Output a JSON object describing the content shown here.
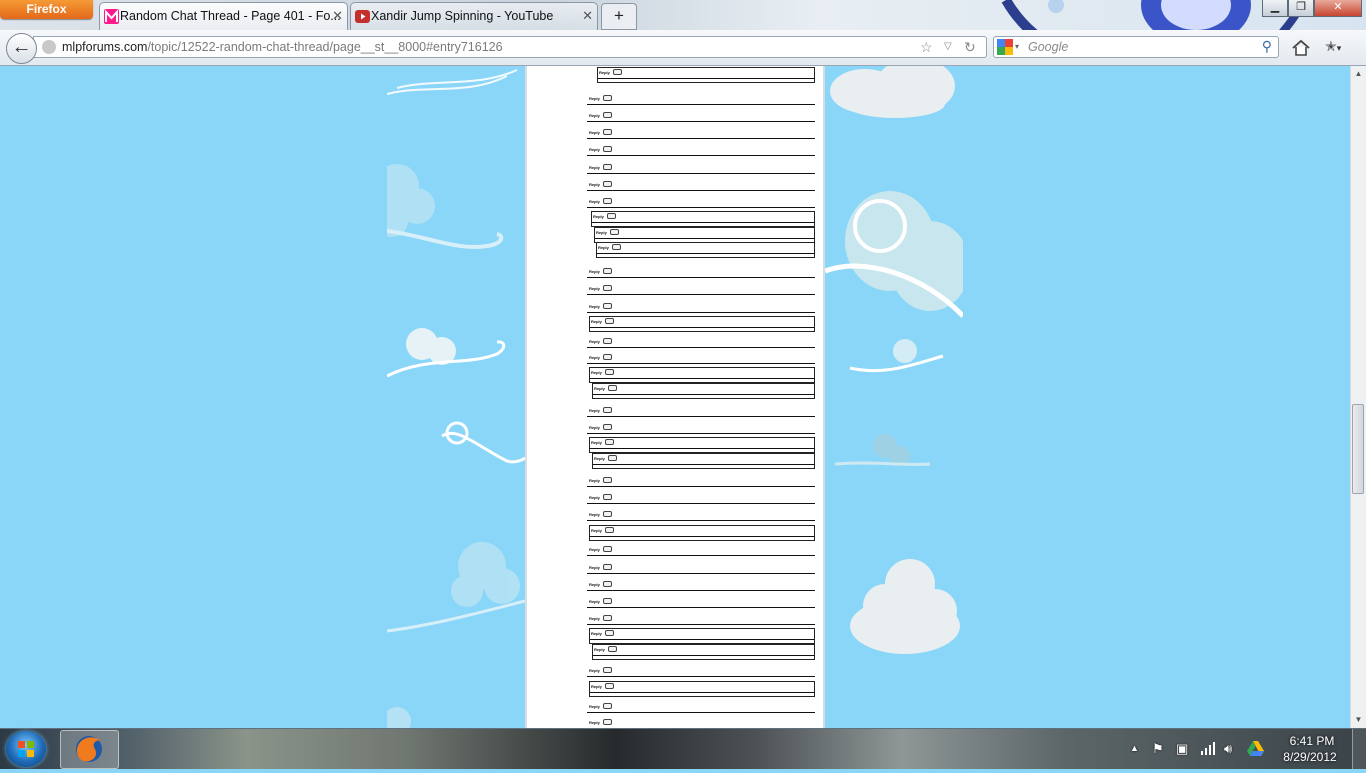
{
  "browser": {
    "menu_button_label": "Firefox",
    "tabs": [
      {
        "label": "Random Chat Thread - Page 401 - Fo...",
        "favicon": "mlp-m-icon",
        "active": true
      },
      {
        "label": "Xandir Jump Spinning - YouTube",
        "favicon": "youtube-icon",
        "active": false
      }
    ],
    "new_tab_label": "+",
    "window_buttons": {
      "minimize": "▁",
      "restore": "❐",
      "close": "✕"
    },
    "url_host": "mlpforums.com",
    "url_path": "/topic/12522-random-chat-thread/page__st__8000#entry716126",
    "search_placeholder": "Google"
  },
  "page": {
    "reply_label": "Reply",
    "colors": {
      "sky": "#8ad6f8",
      "cloud": "#eaf4f8",
      "cloud_dark": "#d8ecf3"
    }
  },
  "taskbar": {
    "time": "6:41 PM",
    "date": "8/29/2012"
  }
}
